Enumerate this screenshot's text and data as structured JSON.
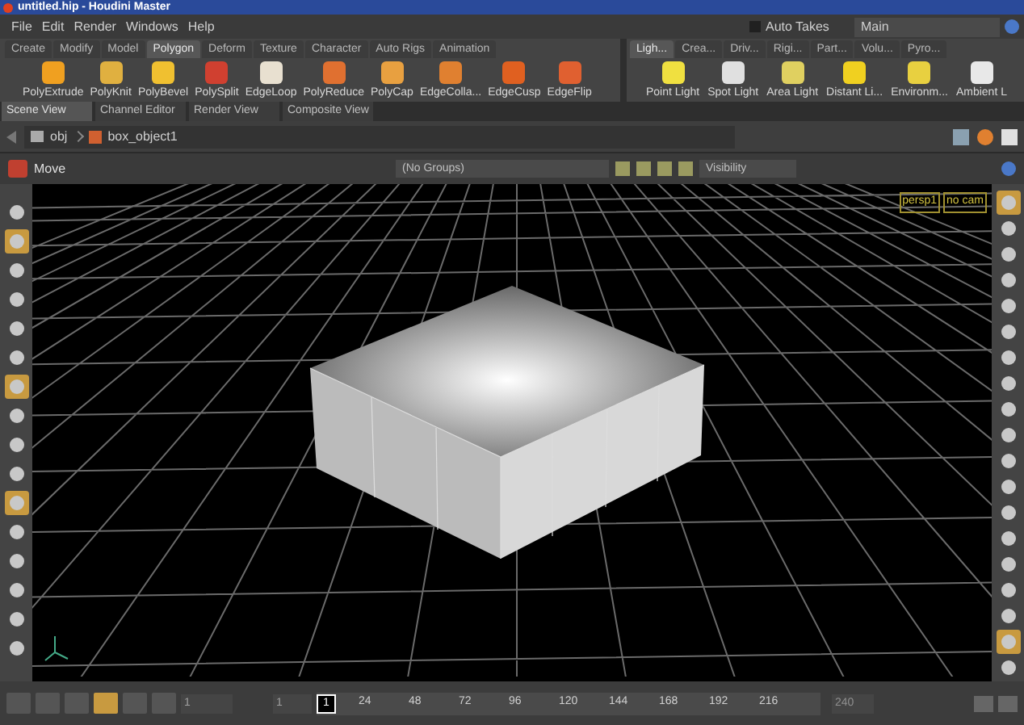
{
  "window": {
    "title": "untitled.hip - Houdini Master"
  },
  "menu": [
    "File",
    "Edit",
    "Render",
    "Windows",
    "Help"
  ],
  "auto_takes": {
    "label": "Auto Takes",
    "checked": false
  },
  "take": {
    "value": "Main"
  },
  "shelf_left": {
    "tabs": [
      {
        "label": "Create",
        "selected": false
      },
      {
        "label": "Modify",
        "selected": false
      },
      {
        "label": "Model",
        "selected": false
      },
      {
        "label": "Polygon",
        "selected": true
      },
      {
        "label": "Deform",
        "selected": false
      },
      {
        "label": "Texture",
        "selected": false
      },
      {
        "label": "Character",
        "selected": false
      },
      {
        "label": "Auto Rigs",
        "selected": false
      },
      {
        "label": "Animation",
        "selected": false
      }
    ],
    "tools": [
      "PolyExtrude",
      "PolyKnit",
      "PolyBevel",
      "PolySplit",
      "EdgeLoop",
      "PolyReduce",
      "PolyCap",
      "EdgeColla...",
      "EdgeCusp",
      "EdgeFlip"
    ]
  },
  "shelf_right": {
    "tabs": [
      {
        "label": "Ligh...",
        "selected": true
      },
      {
        "label": "Crea...",
        "selected": false
      },
      {
        "label": "Driv...",
        "selected": false
      },
      {
        "label": "Rigi...",
        "selected": false
      },
      {
        "label": "Part...",
        "selected": false
      },
      {
        "label": "Volu...",
        "selected": false
      },
      {
        "label": "Pyro...",
        "selected": false
      }
    ],
    "tools": [
      "Point Light",
      "Spot Light",
      "Area Light",
      "Distant Li...",
      "Environm...",
      "Ambient L"
    ]
  },
  "pane_tabs": [
    {
      "label": "Scene View",
      "selected": true
    },
    {
      "label": "Channel Editor",
      "selected": false
    },
    {
      "label": "Render View",
      "selected": false
    },
    {
      "label": "Composite View",
      "selected": false
    }
  ],
  "path": [
    "obj",
    "box_object1"
  ],
  "operation": {
    "label": "Move",
    "group": "(No Groups)",
    "visibility": "Visibility"
  },
  "viewport": {
    "camera": "persp1",
    "cam_menu": "no cam"
  },
  "left_tools": [
    {
      "selected": false
    },
    {
      "selected": true
    },
    {
      "selected": false
    },
    {
      "selected": false
    },
    {
      "selected": false
    },
    {
      "selected": false
    },
    {
      "selected": true
    },
    {
      "selected": false
    },
    {
      "selected": false
    },
    {
      "selected": false
    },
    {
      "selected": true
    },
    {
      "selected": false
    },
    {
      "selected": false
    },
    {
      "selected": false
    },
    {
      "selected": false
    },
    {
      "selected": false
    }
  ],
  "right_tools": [
    {
      "selected": true
    },
    {
      "selected": false
    },
    {
      "selected": false
    },
    {
      "selected": false
    },
    {
      "selected": false
    },
    {
      "selected": false
    },
    {
      "selected": false
    },
    {
      "selected": false
    },
    {
      "selected": false
    },
    {
      "selected": false
    },
    {
      "selected": false
    },
    {
      "selected": false
    },
    {
      "selected": false
    },
    {
      "selected": false
    },
    {
      "selected": false
    },
    {
      "selected": false
    },
    {
      "selected": false
    },
    {
      "selected": true
    },
    {
      "selected": false
    }
  ],
  "timeline": {
    "frame_field": "1",
    "start": "1",
    "current": "1",
    "ticks": [
      "24",
      "48",
      "72",
      "96",
      "120",
      "144",
      "168",
      "192",
      "216"
    ],
    "end": "240"
  }
}
